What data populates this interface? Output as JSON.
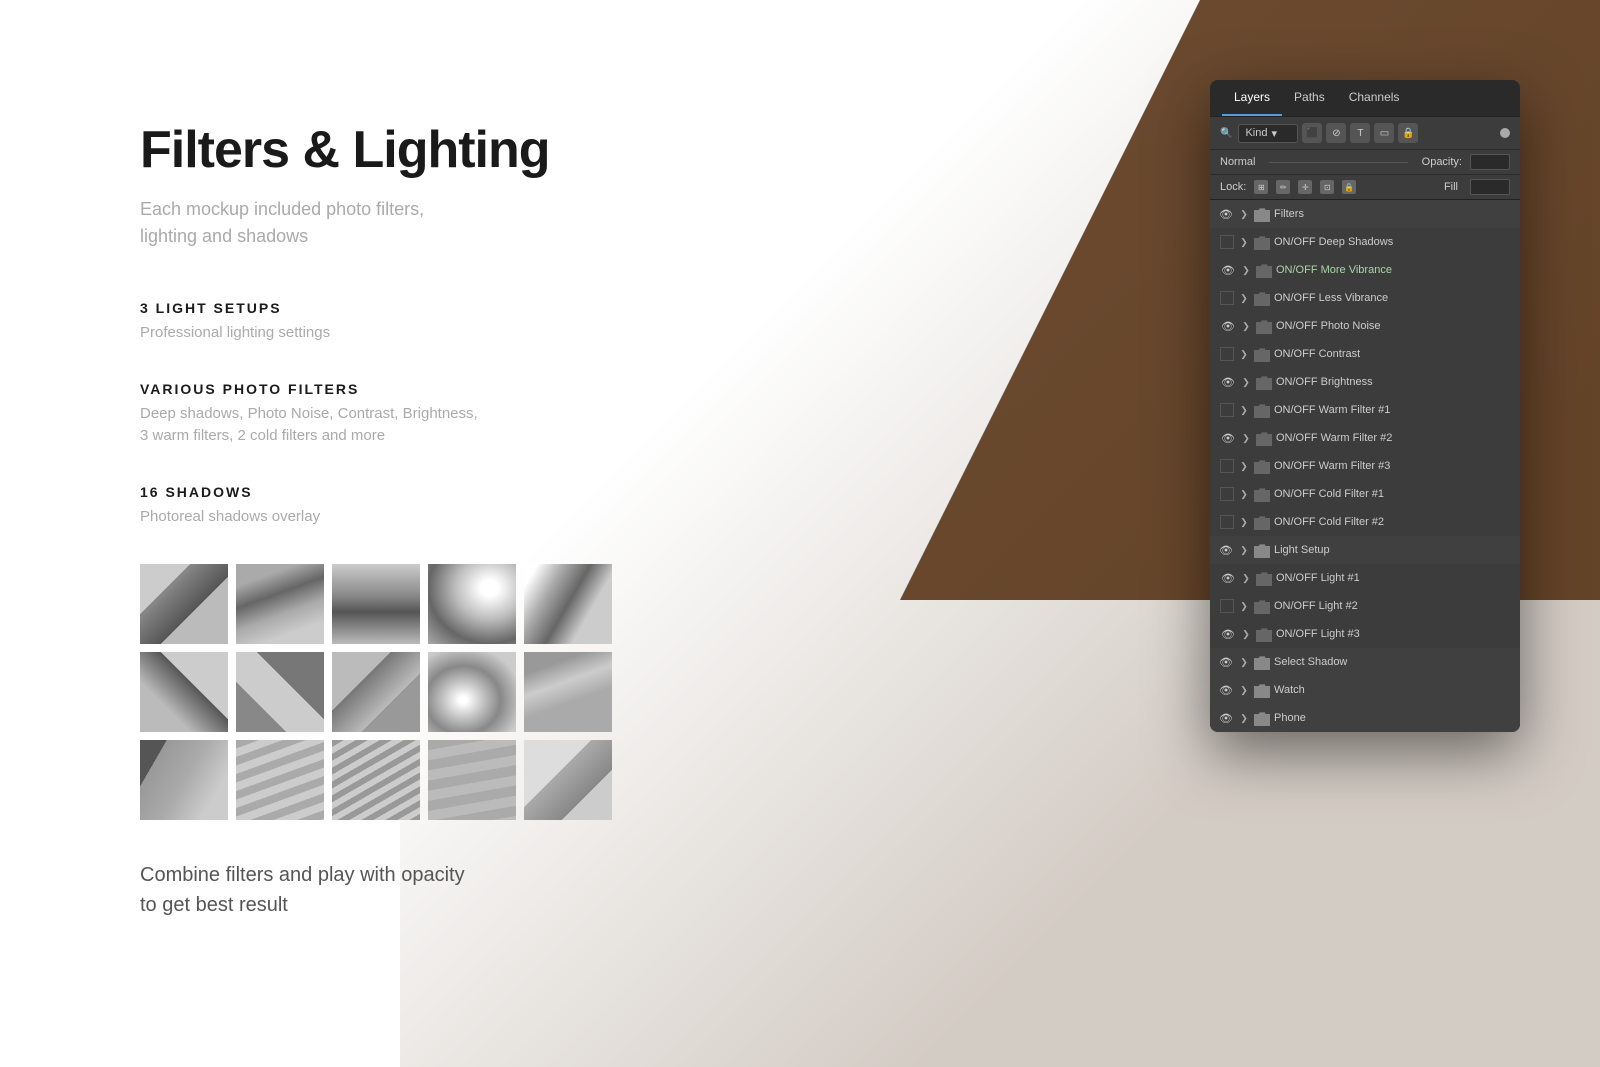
{
  "page": {
    "title": "Filters & Lighting",
    "subtitle_line1": "Each mockup included photo filters,",
    "subtitle_line2": "lighting and shadows"
  },
  "sections": [
    {
      "id": "light-setups",
      "heading": "3 LIGHT SETUPS",
      "description": "Professional lighting settings"
    },
    {
      "id": "photo-filters",
      "heading": "VARIOUS PHOTO FILTERS",
      "description_line1": "Deep shadows, Photo Noise, Contrast, Brightness,",
      "description_line2": "3 warm filters, 2 cold filters and more"
    },
    {
      "id": "shadows",
      "heading": "16 SHADOWS",
      "description": "Photoreal shadows overlay"
    }
  ],
  "combine_text_line1": "Combine filters and play with opacity",
  "combine_text_line2": "to get best result",
  "ps_panel": {
    "tabs": [
      "Layers",
      "Paths",
      "Channels"
    ],
    "active_tab": "Layers",
    "kind_label": "Kind",
    "normal_label": "Normal",
    "opacity_label": "Opacity:",
    "lock_label": "Lock:",
    "fill_label": "Fill",
    "layers": [
      {
        "id": "filters-group",
        "type": "group",
        "label": "Filters",
        "visible": true,
        "expanded": true,
        "indent": 0
      },
      {
        "id": "deep-shadows",
        "type": "layer",
        "label": "ON/OFF Deep Shadows",
        "visible": false,
        "indent": 1
      },
      {
        "id": "more-vibrance",
        "type": "layer",
        "label": "ON/OFF More Vibrance",
        "visible": true,
        "vibrance": true,
        "indent": 1
      },
      {
        "id": "less-vibrance",
        "type": "layer",
        "label": "ON/OFF Less Vibrance",
        "visible": false,
        "indent": 1
      },
      {
        "id": "photo-noise",
        "type": "layer",
        "label": "ON/OFF Photo Noise",
        "visible": true,
        "indent": 1
      },
      {
        "id": "contrast",
        "type": "layer",
        "label": "ON/OFF Contrast",
        "visible": false,
        "indent": 1
      },
      {
        "id": "brightness",
        "type": "layer",
        "label": "ON/OFF Brightness",
        "visible": true,
        "indent": 1
      },
      {
        "id": "warm-filter-1",
        "type": "layer",
        "label": "ON/OFF Warm Filter #1",
        "visible": false,
        "indent": 1
      },
      {
        "id": "warm-filter-2",
        "type": "layer",
        "label": "ON/OFF Warm Filter #2",
        "visible": true,
        "indent": 1
      },
      {
        "id": "warm-filter-3",
        "type": "layer",
        "label": "ON/OFF Warm Filter #3",
        "visible": false,
        "indent": 1
      },
      {
        "id": "cold-filter-1",
        "type": "layer",
        "label": "ON/OFF Cold Filter #1",
        "visible": false,
        "indent": 1
      },
      {
        "id": "cold-filter-2",
        "type": "layer",
        "label": "ON/OFF Cold Filter #2",
        "visible": false,
        "indent": 1
      },
      {
        "id": "light-setup-group",
        "type": "group",
        "label": "Light Setup",
        "visible": true,
        "expanded": true,
        "indent": 0
      },
      {
        "id": "light-1",
        "type": "layer",
        "label": "ON/OFF Light #1",
        "visible": true,
        "indent": 1
      },
      {
        "id": "light-2",
        "type": "layer",
        "label": "ON/OFF Light #2",
        "visible": false,
        "indent": 1
      },
      {
        "id": "light-3",
        "type": "layer",
        "label": "ON/OFF Light #3",
        "visible": true,
        "indent": 1
      },
      {
        "id": "select-shadow-group",
        "type": "group",
        "label": "Select Shadow",
        "visible": true,
        "expanded": false,
        "indent": 0
      },
      {
        "id": "watch-group",
        "type": "group",
        "label": "Watch",
        "visible": true,
        "expanded": false,
        "indent": 0
      },
      {
        "id": "phone-group",
        "type": "group",
        "label": "Phone",
        "visible": true,
        "expanded": false,
        "indent": 0
      }
    ]
  }
}
